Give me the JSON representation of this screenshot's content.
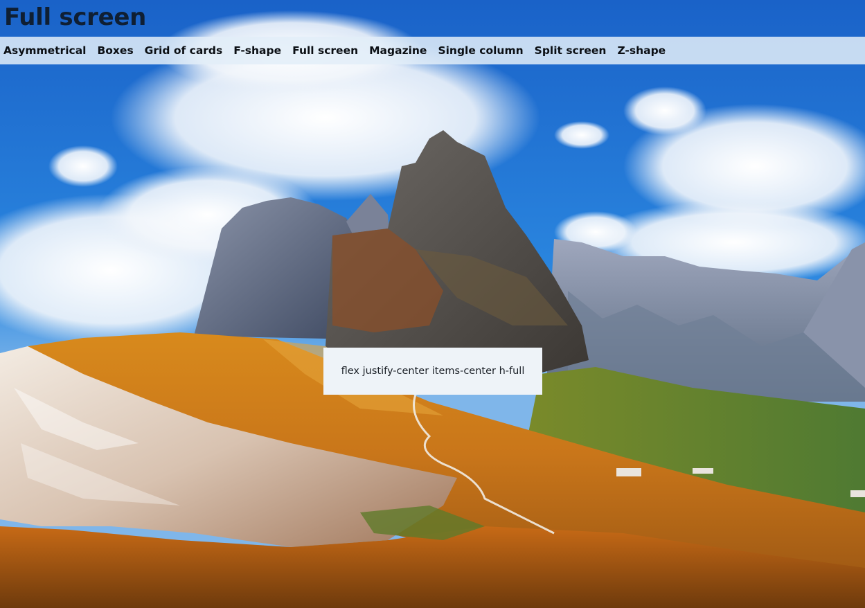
{
  "page": {
    "title": "Full screen"
  },
  "nav": {
    "items": [
      {
        "label": "Asymmetrical"
      },
      {
        "label": "Boxes"
      },
      {
        "label": "Grid of cards"
      },
      {
        "label": "F-shape"
      },
      {
        "label": "Full screen"
      },
      {
        "label": "Magazine"
      },
      {
        "label": "Single column"
      },
      {
        "label": "Split screen"
      },
      {
        "label": "Z-shape"
      }
    ]
  },
  "content": {
    "box_text": "flex justify-center items-center h-full"
  },
  "background": {
    "image": "mountain-landscape-photo"
  }
}
